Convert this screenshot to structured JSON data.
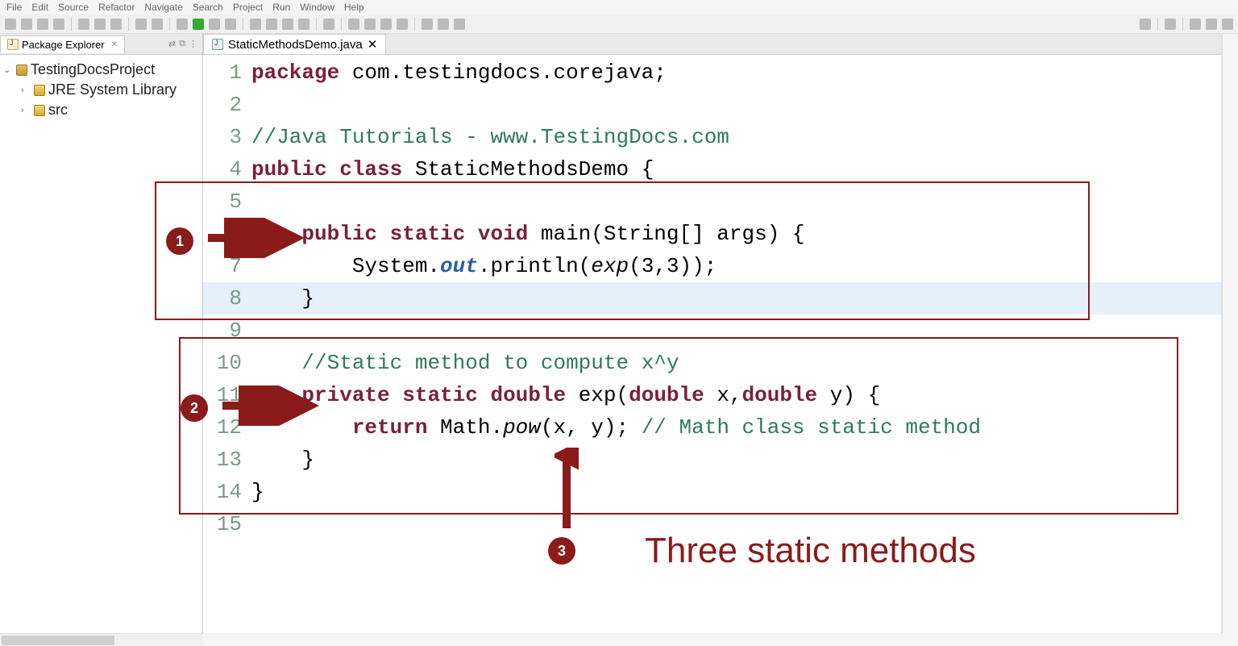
{
  "menu": {
    "items": [
      "File",
      "Edit",
      "Source",
      "Refactor",
      "Navigate",
      "Search",
      "Project",
      "Run",
      "Window",
      "Help"
    ]
  },
  "package_explorer": {
    "title": "Package Explorer",
    "project": "TestingDocsProject",
    "children": [
      "JRE System Library",
      "src"
    ]
  },
  "editor": {
    "tab": "StaticMethodsDemo.java",
    "lines": [
      {
        "n": "1",
        "segs": [
          {
            "t": "package ",
            "c": "kw"
          },
          {
            "t": "com.testingdocs.corejava;",
            "c": ""
          }
        ]
      },
      {
        "n": "2",
        "segs": []
      },
      {
        "n": "3",
        "segs": [
          {
            "t": "//Java Tutorials - www.TestingDocs.com",
            "c": "cmt"
          }
        ]
      },
      {
        "n": "4",
        "segs": [
          {
            "t": "public class ",
            "c": "kw"
          },
          {
            "t": "StaticMethodsDemo {",
            "c": ""
          }
        ]
      },
      {
        "n": "5",
        "segs": []
      },
      {
        "n": "6",
        "segs": [
          {
            "t": "    ",
            "c": ""
          },
          {
            "t": "public static void ",
            "c": "kw"
          },
          {
            "t": "main(String[] args) {",
            "c": ""
          }
        ]
      },
      {
        "n": "7",
        "segs": [
          {
            "t": "        System.",
            "c": ""
          },
          {
            "t": "out",
            "c": "sf"
          },
          {
            "t": ".println(",
            "c": ""
          },
          {
            "t": "exp",
            "c": "em"
          },
          {
            "t": "(3,3));",
            "c": ""
          }
        ]
      },
      {
        "n": "8",
        "segs": [
          {
            "t": "    }",
            "c": ""
          }
        ],
        "hl": true
      },
      {
        "n": "9",
        "segs": []
      },
      {
        "n": "10",
        "segs": [
          {
            "t": "    ",
            "c": ""
          },
          {
            "t": "//Static method to compute x^y",
            "c": "cmt"
          }
        ]
      },
      {
        "n": "11",
        "segs": [
          {
            "t": "    ",
            "c": ""
          },
          {
            "t": "private static double ",
            "c": "kw"
          },
          {
            "t": "exp(",
            "c": ""
          },
          {
            "t": "double ",
            "c": "kw"
          },
          {
            "t": "x,",
            "c": ""
          },
          {
            "t": "double ",
            "c": "kw"
          },
          {
            "t": "y) {",
            "c": ""
          }
        ]
      },
      {
        "n": "12",
        "segs": [
          {
            "t": "        ",
            "c": ""
          },
          {
            "t": "return ",
            "c": "kw"
          },
          {
            "t": "Math.",
            "c": ""
          },
          {
            "t": "pow",
            "c": "em"
          },
          {
            "t": "(x, y); ",
            "c": ""
          },
          {
            "t": "// Math class static method",
            "c": "cmt"
          }
        ]
      },
      {
        "n": "13",
        "segs": [
          {
            "t": "    }",
            "c": ""
          }
        ]
      },
      {
        "n": "14",
        "segs": [
          {
            "t": "}",
            "c": ""
          }
        ]
      },
      {
        "n": "15",
        "segs": []
      }
    ]
  },
  "annotations": {
    "badge1": "1",
    "badge2": "2",
    "badge3": "3",
    "label": "Three static methods"
  }
}
